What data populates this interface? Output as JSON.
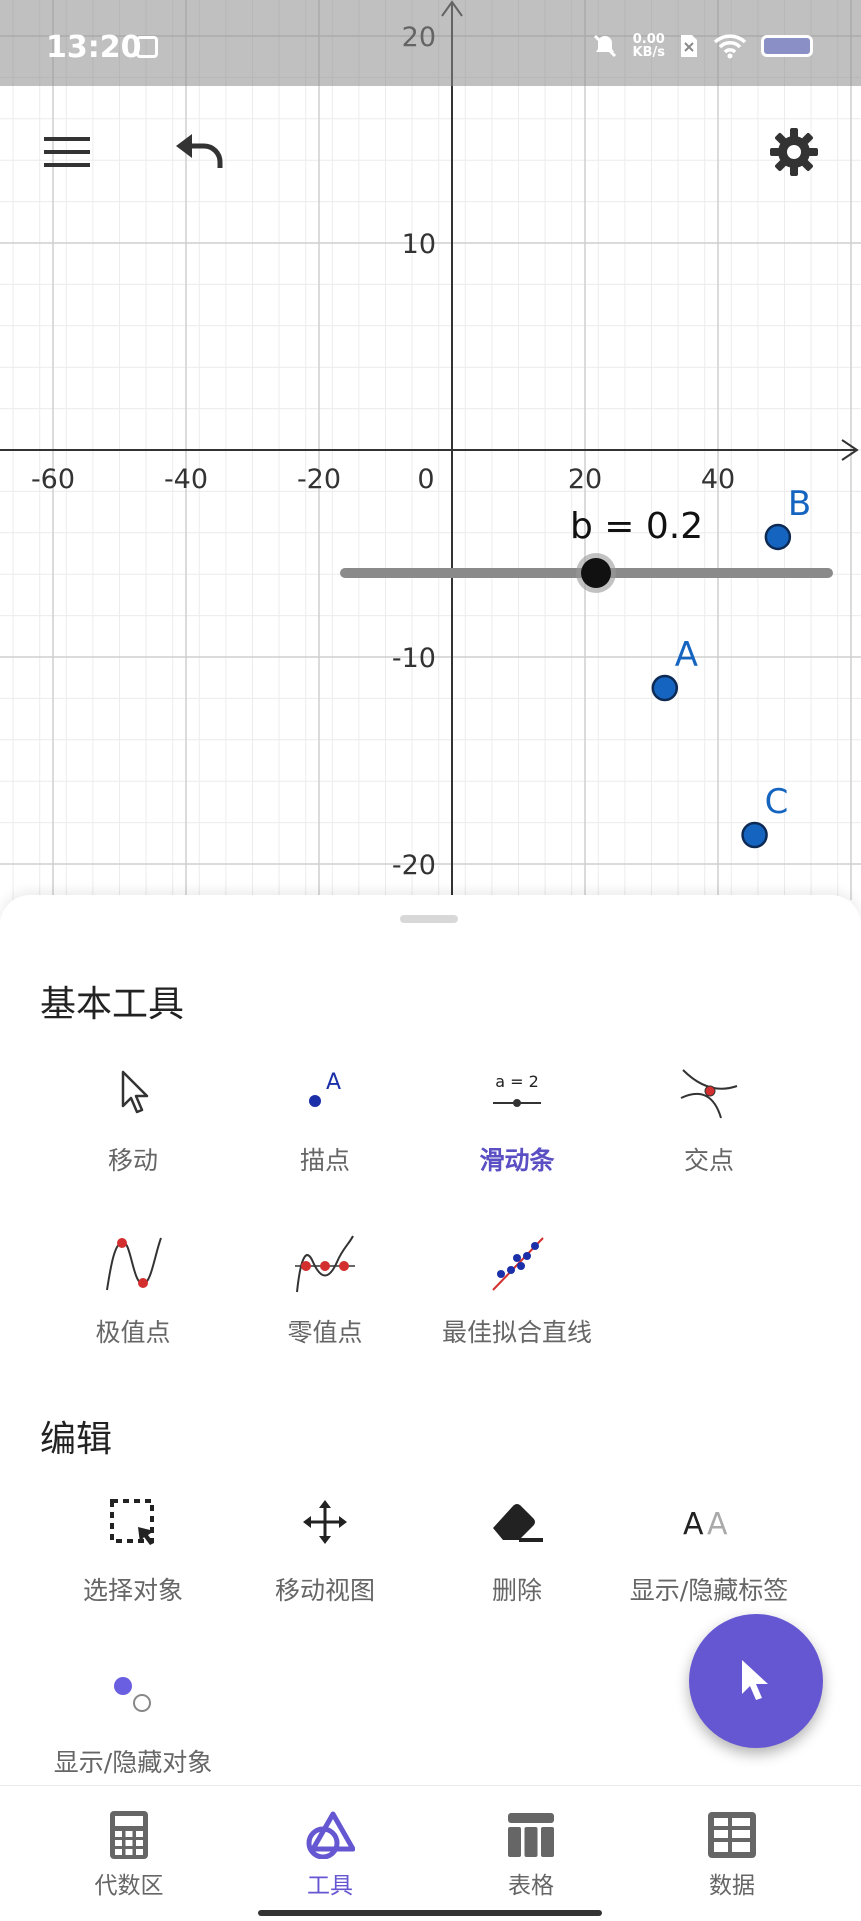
{
  "status_bar": {
    "time": "13:20",
    "net_speed_value": "0.00",
    "net_speed_unit": "KB/s"
  },
  "toolbar": {
    "menu_icon": "hamburger-icon",
    "undo_icon": "undo-icon",
    "settings_icon": "gear-icon"
  },
  "graph": {
    "x_ticks": [
      "-60",
      "-40",
      "-20",
      "0",
      "20",
      "40"
    ],
    "y_ticks": [
      "20",
      "10",
      "-10",
      "-20"
    ],
    "points": [
      {
        "label": "A",
        "x": 32,
        "y": -11.5
      },
      {
        "label": "B",
        "x": 49,
        "y": -4.2
      },
      {
        "label": "C",
        "x": 45.5,
        "y": -18.6
      }
    ],
    "slider": {
      "text": "b = 0.2"
    },
    "point_color": "#1565c0"
  },
  "sheet": {
    "section_basic": "基本工具",
    "section_edit": "编辑",
    "basic_tools": [
      {
        "label": "移动",
        "icon": "move-arrow-icon"
      },
      {
        "label": "描点",
        "icon": "point-icon"
      },
      {
        "label": "滑动条",
        "icon": "slider-icon"
      },
      {
        "label": "交点",
        "icon": "intersect-icon"
      },
      {
        "label": "极值点",
        "icon": "extremum-icon"
      },
      {
        "label": "零值点",
        "icon": "roots-icon"
      },
      {
        "label": "最佳拟合直线",
        "icon": "best-fit-line-icon"
      }
    ],
    "edit_tools": [
      {
        "label": "选择对象",
        "icon": "select-objects-icon"
      },
      {
        "label": "移动视图",
        "icon": "move-view-icon"
      },
      {
        "label": "删除",
        "icon": "eraser-icon"
      },
      {
        "label": "显示/隐藏标签",
        "icon": "show-hide-label-icon",
        "icon_text": "AA"
      },
      {
        "label": "显示/隐藏对象",
        "icon": "show-hide-object-icon"
      }
    ],
    "slider_icon_text": "a = 2",
    "point_icon_text": "A"
  },
  "fab": {
    "icon": "cursor-icon"
  },
  "bottom_nav": [
    {
      "label": "代数区",
      "icon": "calculator-icon"
    },
    {
      "label": "工具",
      "icon": "tools-icon"
    },
    {
      "label": "表格",
      "icon": "table-icon"
    },
    {
      "label": "数据",
      "icon": "data-icon"
    }
  ],
  "colors": {
    "accent": "#6557d2",
    "active_label": "#5a4fc3"
  }
}
